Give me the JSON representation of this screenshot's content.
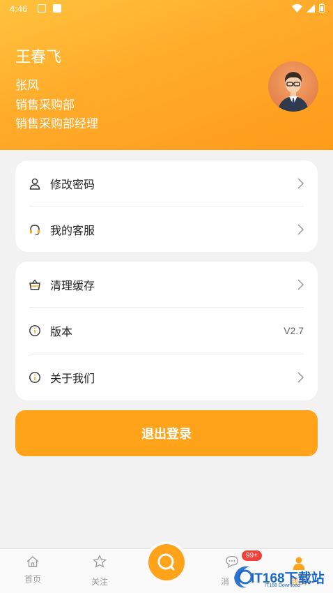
{
  "status_bar": {
    "time": "4:46"
  },
  "profile": {
    "name": "王春飞",
    "user": "张风",
    "department": "销售采购部",
    "title": "销售采购部经理"
  },
  "menu_group1": [
    {
      "label": "修改密码",
      "icon": "person-icon"
    },
    {
      "label": "我的客服",
      "icon": "headset-icon"
    }
  ],
  "menu_group2": [
    {
      "label": "清理缓存",
      "icon": "basket-icon"
    },
    {
      "label": "版本",
      "icon": "info-icon",
      "value": "V2.7"
    },
    {
      "label": "关于我们",
      "icon": "info-icon"
    }
  ],
  "logout_label": "退出登录",
  "tabs": [
    {
      "label": "首页",
      "icon": "home-icon"
    },
    {
      "label": "关注",
      "icon": "star-icon"
    },
    {
      "label": "消",
      "icon": "message-icon",
      "badge": "99+"
    },
    {
      "label": "我的",
      "icon": "user-icon"
    }
  ],
  "watermark": {
    "text": "IT168下载站",
    "sub": "IT168 Download"
  },
  "colors": {
    "accent": "#ffa31a",
    "header_start": "#ffc23d",
    "header_end": "#ff9b1a",
    "badge": "#f0433a"
  }
}
